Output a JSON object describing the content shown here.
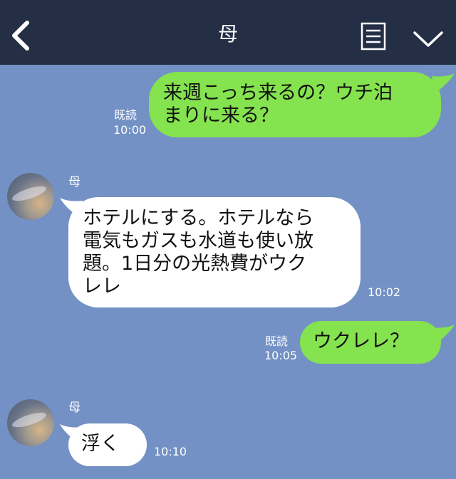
{
  "header": {
    "title": "母",
    "back_icon": "chevron-left-icon",
    "menu_icon": "document-list-icon",
    "dropdown_icon": "chevron-down-icon",
    "bg_color": "#242f46"
  },
  "chat": {
    "bg_color": "#7391c4",
    "outgoing_color": "#84e34e",
    "incoming_color": "#ffffff",
    "messages": [
      {
        "from": "me",
        "lines": [
          "来週こっち来るの？ウチ泊",
          "まりに来る？"
        ],
        "read": "既読",
        "time": "10:00"
      },
      {
        "from": "母",
        "name": "母",
        "lines": [
          "ホテルにする。ホテルなら",
          "電気もガスも水道も使い放",
          "題。1日分の光熱費がウク",
          "レレ"
        ],
        "time": "10:02"
      },
      {
        "from": "me",
        "lines": [
          "ウクレレ？"
        ],
        "read": "既読",
        "time": "10:05"
      },
      {
        "from": "母",
        "name": "母",
        "lines": [
          "浮く"
        ],
        "time": "10:10"
      }
    ]
  }
}
